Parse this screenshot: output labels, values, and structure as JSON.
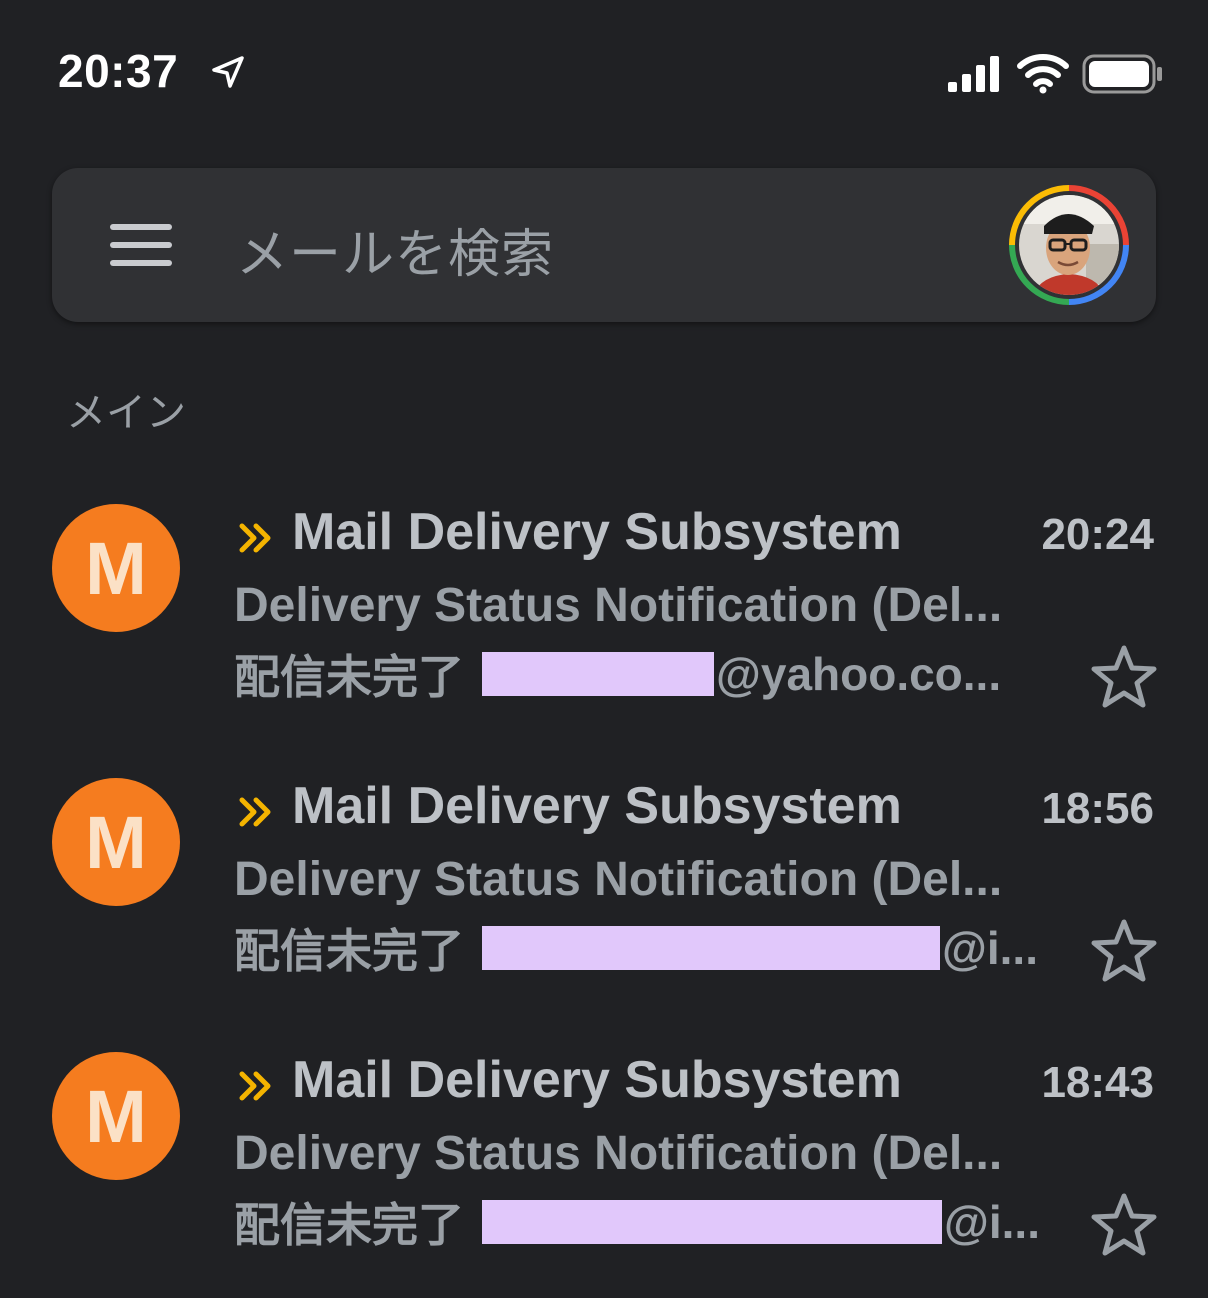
{
  "status_bar": {
    "time": "20:37"
  },
  "search": {
    "placeholder": "メールを検索"
  },
  "section": {
    "label": "メイン"
  },
  "colors": {
    "avatar_bg": "#f57c1f",
    "importance_marker": "#f4b400",
    "redaction": "#e1c8fb"
  },
  "icons": {
    "menu": "hamburger-menu-icon",
    "location": "location-arrow-icon",
    "signal": "cellular-signal-icon",
    "wifi": "wifi-icon",
    "battery": "battery-icon",
    "importance": "important-marker-icon",
    "star": "star-outline-icon"
  },
  "emails": [
    {
      "avatar_letter": "M",
      "sender": "Mail Delivery Subsystem",
      "time": "20:24",
      "subject": "Delivery Status Notification (Del...",
      "snippet_prefix": "配信未完了",
      "snippet_suffix": "@yahoo.co...",
      "important": true,
      "starred": false
    },
    {
      "avatar_letter": "M",
      "sender": "Mail Delivery Subsystem",
      "time": "18:56",
      "subject": "Delivery Status Notification (Del...",
      "snippet_prefix": "配信未完了",
      "snippet_suffix": "@i...",
      "important": true,
      "starred": false
    },
    {
      "avatar_letter": "M",
      "sender": "Mail Delivery Subsystem",
      "time": "18:43",
      "subject": "Delivery Status Notification (Del...",
      "snippet_prefix": "配信未完了",
      "snippet_suffix": "@i...",
      "important": true,
      "starred": false
    }
  ]
}
